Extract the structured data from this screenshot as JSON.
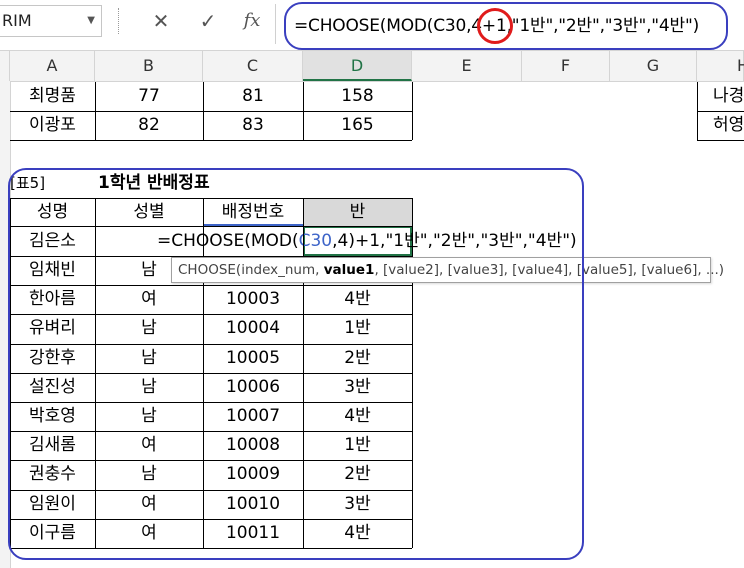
{
  "formula_bar": {
    "name_box": "RIM",
    "cancel_icon": "✕",
    "enter_icon": "✓",
    "fx_label": "fx",
    "formula_parts": [
      "=CHOOSE(MOD(C30,4",
      "+1",
      ",\"1반\",\"2반\",\"3반\",\"4반\")"
    ]
  },
  "columns": [
    "A",
    "B",
    "C",
    "D",
    "E",
    "F",
    "G",
    "H"
  ],
  "top_rows": [
    {
      "name": "최명품",
      "b": "77",
      "c": "81",
      "d": "158"
    },
    {
      "name": "이광포",
      "b": "82",
      "c": "83",
      "d": "165"
    }
  ],
  "right_fragments": [
    "나경",
    "허영"
  ],
  "table": {
    "label": "[표5]",
    "title": "1학년 반배정표",
    "headers": [
      "성명",
      "성별",
      "배정번호",
      "반"
    ],
    "edit_row_name": "김은소",
    "edit_formula_parts": [
      "=CHOOSE(MOD(",
      "C30",
      ",4)+1,\"1반\",\"2반\",\"3반\",\"4반\")"
    ],
    "rows": [
      {
        "name": "임채빈",
        "gender": "남",
        "num": "",
        "cls": ""
      },
      {
        "name": "한아름",
        "gender": "여",
        "num": "10003",
        "cls": "4반"
      },
      {
        "name": "유벼리",
        "gender": "남",
        "num": "10004",
        "cls": "1반"
      },
      {
        "name": "강한후",
        "gender": "남",
        "num": "10005",
        "cls": "2반"
      },
      {
        "name": "설진성",
        "gender": "남",
        "num": "10006",
        "cls": "3반"
      },
      {
        "name": "박호영",
        "gender": "남",
        "num": "10007",
        "cls": "4반"
      },
      {
        "name": "김새롬",
        "gender": "여",
        "num": "10008",
        "cls": "1반"
      },
      {
        "name": "권충수",
        "gender": "남",
        "num": "10009",
        "cls": "2반"
      },
      {
        "name": "임원이",
        "gender": "여",
        "num": "10010",
        "cls": "3반"
      },
      {
        "name": "이구름",
        "gender": "여",
        "num": "10011",
        "cls": "4반"
      }
    ]
  },
  "tooltip": {
    "func": "CHOOSE(index_num, ",
    "bold": "value1",
    "rest": ", [value2], [value3], [value4], [value5], [value6], ...)"
  },
  "colors": {
    "annotation_blue": "#3a3fbf",
    "annotation_red": "#e01b1b",
    "selected_col": "#217346",
    "ref_blue": "#3d64c8"
  }
}
